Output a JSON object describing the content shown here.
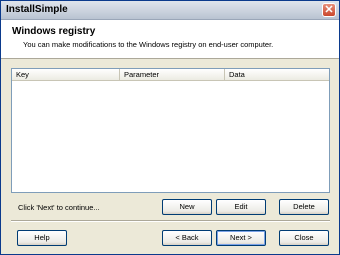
{
  "window": {
    "title": "InstallSimple",
    "close_glyph": "✕"
  },
  "header": {
    "title": "Windows registry",
    "subtitle": "You can make modifications to the Windows registry on end-user computer."
  },
  "list": {
    "columns": [
      "Key",
      "Parameter",
      "Data"
    ],
    "rows": []
  },
  "status": {
    "text": "Click 'Next' to continue..."
  },
  "buttons": {
    "new": "New",
    "edit": "Edit",
    "delete": "Delete",
    "help": "Help",
    "back": "< Back",
    "next": "Next >",
    "close": "Close"
  },
  "icons": {
    "close": "close-icon"
  }
}
